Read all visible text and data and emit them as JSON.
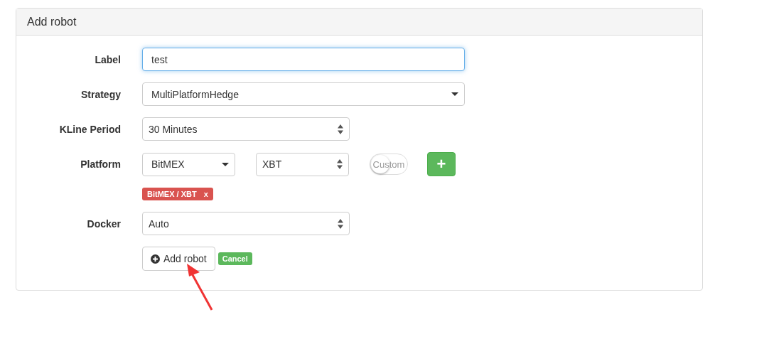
{
  "panel": {
    "title": "Add robot"
  },
  "fields": [
    {
      "label": "Label",
      "controls": [
        {
          "kind": "input",
          "value": "test",
          "focused": true
        }
      ]
    },
    {
      "label": "Strategy",
      "controls": [
        {
          "kind": "dropdown",
          "value": "MultiPlatformHedge"
        }
      ]
    },
    {
      "label": "KLine Period",
      "controls": [
        {
          "kind": "select",
          "value": "30 Minutes"
        }
      ]
    },
    {
      "label": "Platform",
      "controls": [
        {
          "kind": "dropdown",
          "value": "BitMEX"
        },
        {
          "kind": "select",
          "value": "XBT"
        },
        {
          "kind": "toggle",
          "label": "Custom",
          "on": false
        },
        {
          "kind": "add",
          "label": "+"
        }
      ]
    },
    {
      "tags": [
        {
          "text": "BitMEX / XBT",
          "remove": "x"
        }
      ]
    },
    {
      "label": "Docker",
      "controls": [
        {
          "kind": "select",
          "value": "Auto"
        }
      ]
    }
  ],
  "actions": [
    {
      "kind": "default",
      "label": "Add robot",
      "icon": true
    },
    {
      "kind": "success",
      "label": "Cancel"
    }
  ],
  "annotation": {
    "kind": "arrow"
  }
}
